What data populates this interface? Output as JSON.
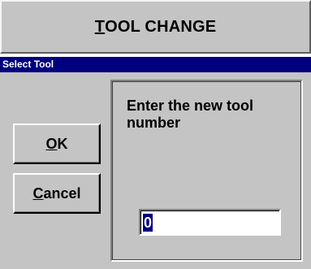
{
  "header": {
    "title_accel": "T",
    "title_rest": "OOL CHANGE"
  },
  "dialog": {
    "title": "Select Tool",
    "ok_accel": "O",
    "ok_rest": "K",
    "cancel_accel": "C",
    "cancel_rest": "ancel",
    "prompt": "Enter the new tool number",
    "tool_number_value": "0"
  },
  "colors": {
    "titlebar": "#00007f",
    "face": "#c4c4c4",
    "selection": "#00007f"
  }
}
